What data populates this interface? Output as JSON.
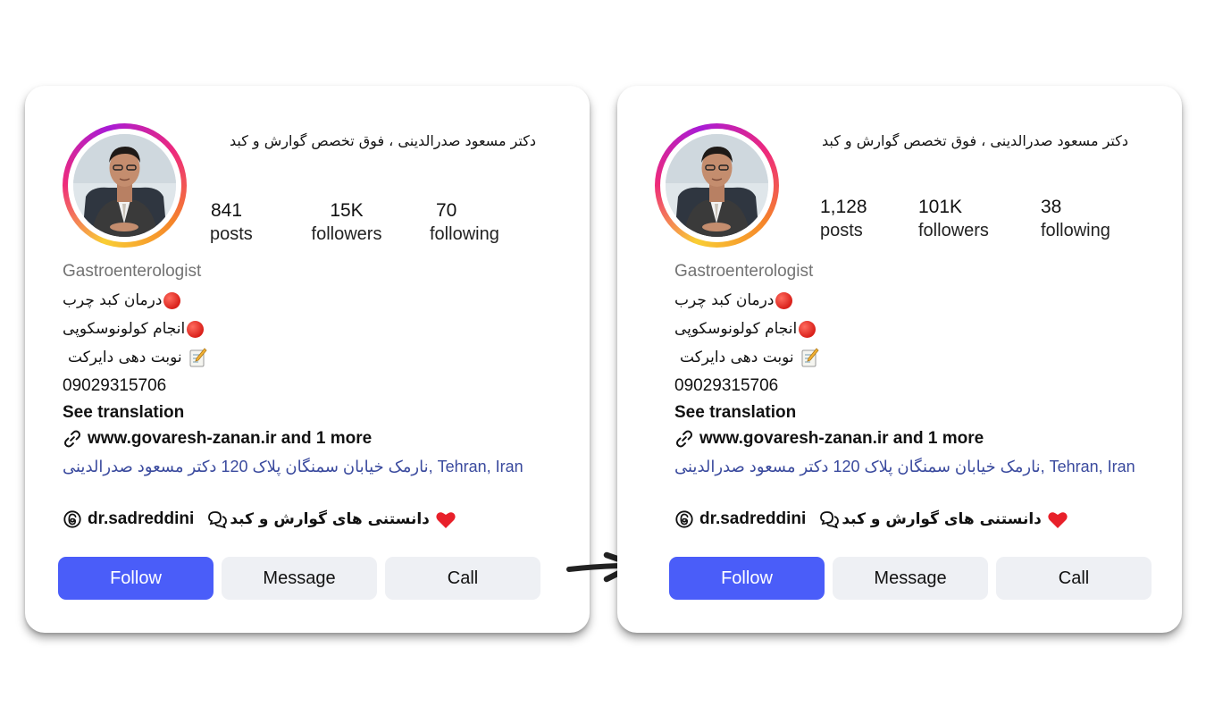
{
  "profiles": [
    {
      "full_name": "دکتر مسعود صدرالدینی ، فوق تخصص گوارش و کبد",
      "stats": {
        "posts_count": "841",
        "posts_label": "posts",
        "followers_count": "15K",
        "followers_label": "followers",
        "following_count": "70",
        "following_label": "following"
      },
      "category": "Gastroenterologist",
      "bio_lines": [
        "درمان کبد چرب",
        "انجام کولونوسکوپی",
        "نوبت دهی دایرکت"
      ],
      "phone": "09029315706",
      "see_translation": "See translation",
      "link_text": "www.govaresh-zanan.ir and 1 more",
      "address": "نارمک خیابان سمنگان پلاک 120 دکتر مسعود صدرالدینی, Tehran, Iran",
      "threads_handle": "dr.sadreddini",
      "threads_text": "دانستنی های گوارش و کبد",
      "buttons": {
        "follow": "Follow",
        "message": "Message",
        "call": "Call"
      }
    },
    {
      "full_name": "دکتر مسعود صدرالدینی ، فوق تخصص گوارش و کبد",
      "stats": {
        "posts_count": "1,128",
        "posts_label": "posts",
        "followers_count": "101K",
        "followers_label": "followers",
        "following_count": "38",
        "following_label": "following"
      },
      "category": "Gastroenterologist",
      "bio_lines": [
        "درمان کبد چرب",
        "انجام کولونوسکوپی",
        "نوبت دهی دایرکت"
      ],
      "phone": "09029315706",
      "see_translation": "See translation",
      "link_text": "www.govaresh-zanan.ir and 1 more",
      "address": "نارمک خیابان سمنگان پلاک 120 دکتر مسعود صدرالدینی, Tehran, Iran",
      "threads_handle": "dr.sadreddini",
      "threads_text": "دانستنی های گوارش و کبد",
      "buttons": {
        "follow": "Follow",
        "message": "Message",
        "call": "Call"
      }
    }
  ],
  "icons": {
    "bio_bullet": "red-circle-icon",
    "bio_note": "memo-icon",
    "link": "link-icon",
    "threads": "threads-icon",
    "bubble": "chat-bubble-icon",
    "heart": "heart-icon",
    "transition": "arrow-right-icon"
  },
  "colors": {
    "follow_button": "#4a5df9",
    "secondary_button": "#eef0f4",
    "address_text": "#3a4a9e",
    "category_text": "#737373"
  }
}
